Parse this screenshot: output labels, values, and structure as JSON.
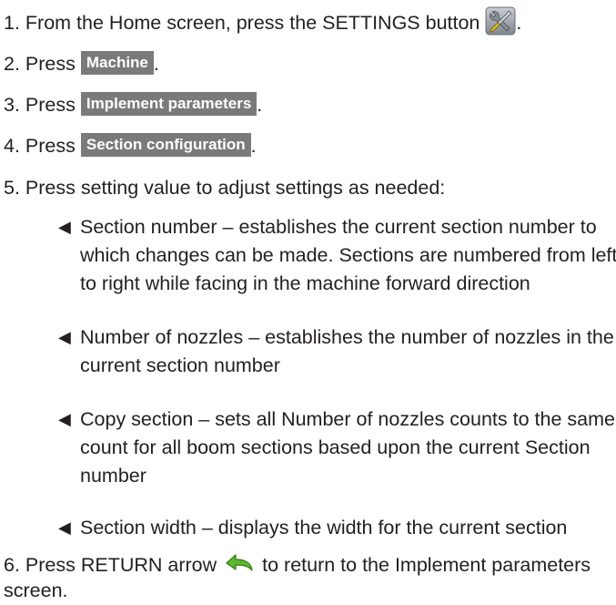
{
  "steps": [
    {
      "num": "1.",
      "pre": "From the Home screen, press the SETTINGS button",
      "post": "."
    },
    {
      "num": "2.",
      "pre": "Press",
      "button": "Machine",
      "post": "."
    },
    {
      "num": "3.",
      "pre": "Press",
      "button": "Implement parameters",
      "post": "."
    },
    {
      "num": "4.",
      "pre": "Press",
      "button": "Section configuration",
      "post": "."
    },
    {
      "num": "5.",
      "pre": "Press setting value to adjust settings as needed:"
    },
    {
      "num": "6.",
      "pre": "Press RETURN arrow",
      "post": "to return to the Implement parameters",
      "post2": "screen."
    }
  ],
  "bullet_symbol": "◀",
  "bullets": [
    {
      "lines": [
        "Section number – establishes the current section number to",
        "which changes can be made. Sections are numbered from left",
        "to right while facing in the machine forward direction"
      ]
    },
    {
      "lines": [
        "Number of nozzles – establishes the number of nozzles in the",
        "current section number"
      ]
    },
    {
      "lines": [
        "Copy section – sets all Number of nozzles counts to the same",
        "count for all boom sections based upon the current Section",
        "number"
      ]
    },
    {
      "lines": [
        "Section width – displays the width for the current section"
      ]
    }
  ],
  "icons": {
    "settings": "settings-tools-icon",
    "return": "return-arrow-icon"
  },
  "colors": {
    "text": "#231f20",
    "button_bg": "#7a7a7a",
    "button_text": "#ffffff",
    "return_arrow": "#5cb82e"
  }
}
